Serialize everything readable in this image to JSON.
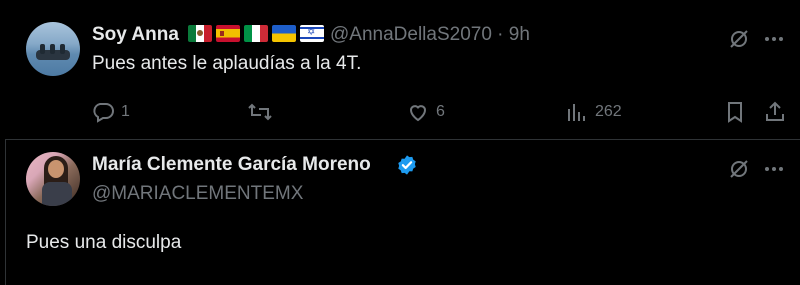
{
  "tweet1": {
    "name": "Soy Anna",
    "flags": [
      "mexico-flag",
      "spain-flag",
      "italy-flag",
      "ukraine-flag",
      "israel-flag"
    ],
    "handle_time": "@AnnaDellaS2070 · 9h",
    "text": "Pues antes le aplaudías a la 4T.",
    "actions": {
      "replies": "1",
      "retweets": "",
      "likes": "6",
      "views": "262"
    }
  },
  "tweet2": {
    "name": "María Clemente García Moreno",
    "handle": "@MARIACLEMENTEMX",
    "text": "Pues una disculpa"
  },
  "colors": {
    "background": "#000000",
    "text": "#e7e9ea",
    "muted": "#71767b",
    "divider": "#2f3336",
    "verified": "#1d9bf0"
  }
}
